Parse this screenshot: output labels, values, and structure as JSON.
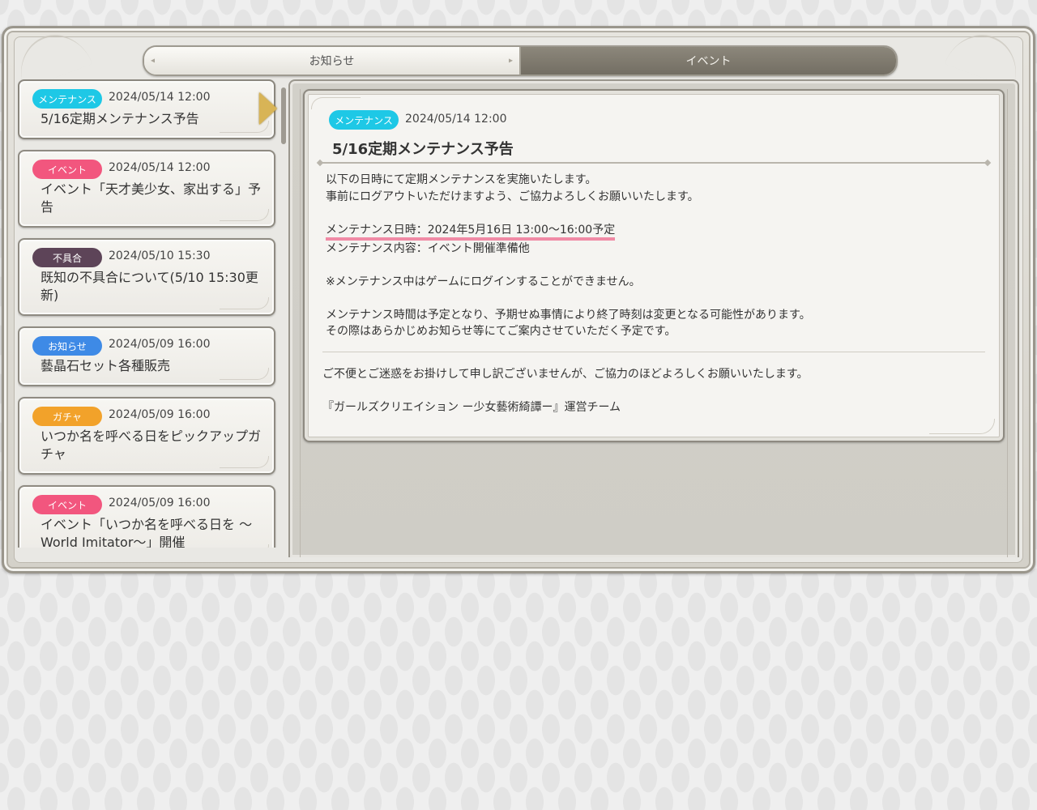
{
  "tabs": [
    {
      "label": "お知らせ",
      "active": false
    },
    {
      "label": "イベント",
      "active": true
    }
  ],
  "colors": {
    "maintenance": "#1ec8e6",
    "event": "#f2567e",
    "bug": "#5d4458",
    "notice": "#3e8ae6",
    "gacha": "#f2a22a",
    "highlight": "#f08aa5"
  },
  "list": [
    {
      "badge": "メンテナンス",
      "badge_color": "maintenance",
      "date": "2024/05/14 12:00",
      "title": "5/16定期メンテナンス予告",
      "selected": true
    },
    {
      "badge": "イベント",
      "badge_color": "event",
      "date": "2024/05/14 12:00",
      "title": "イベント「天才美少女、家出する」予告"
    },
    {
      "badge": "不具合",
      "badge_color": "bug",
      "date": "2024/05/10 15:30",
      "title": "既知の不具合について(5/10 15:30更新)"
    },
    {
      "badge": "お知らせ",
      "badge_color": "notice",
      "date": "2024/05/09 16:00",
      "title": "藝晶石セット各種販売"
    },
    {
      "badge": "ガチャ",
      "badge_color": "gacha",
      "date": "2024/05/09 16:00",
      "title": "いつか名を呼べる日をピックアップガチャ"
    },
    {
      "badge": "イベント",
      "badge_color": "event",
      "date": "2024/05/09 16:00",
      "title": "イベント「いつか名を呼べる日を 〜World Imitator〜」開催"
    }
  ],
  "article": {
    "badge": "メンテナンス",
    "date": "2024/05/14 12:00",
    "title": "5/16定期メンテナンス予告",
    "line1": "以下の日時にて定期メンテナンスを実施いたします。",
    "line2": "事前にログアウトいただけますよう、ご協力よろしくお願いいたします。",
    "line3": "メンテナンス日時：2024年5月16日 13:00〜16:00予定",
    "line4": "メンテナンス内容：イベント開催準備他",
    "line5": "※メンテナンス中はゲームにログインすることができません。",
    "line6": "メンテナンス時間は予定となり、予期せぬ事情により終了時刻は変更となる可能性があります。",
    "line7": "その際はあらかじめお知らせ等にてご案内させていただく予定です。",
    "closing1": "ご不便とご迷惑をお掛けして申し訳ございませんが、ご協力のほどよろしくお願いいたします。",
    "closing2": "『ガールズクリエイション ー少女藝術綺譚ー』運営チーム"
  }
}
